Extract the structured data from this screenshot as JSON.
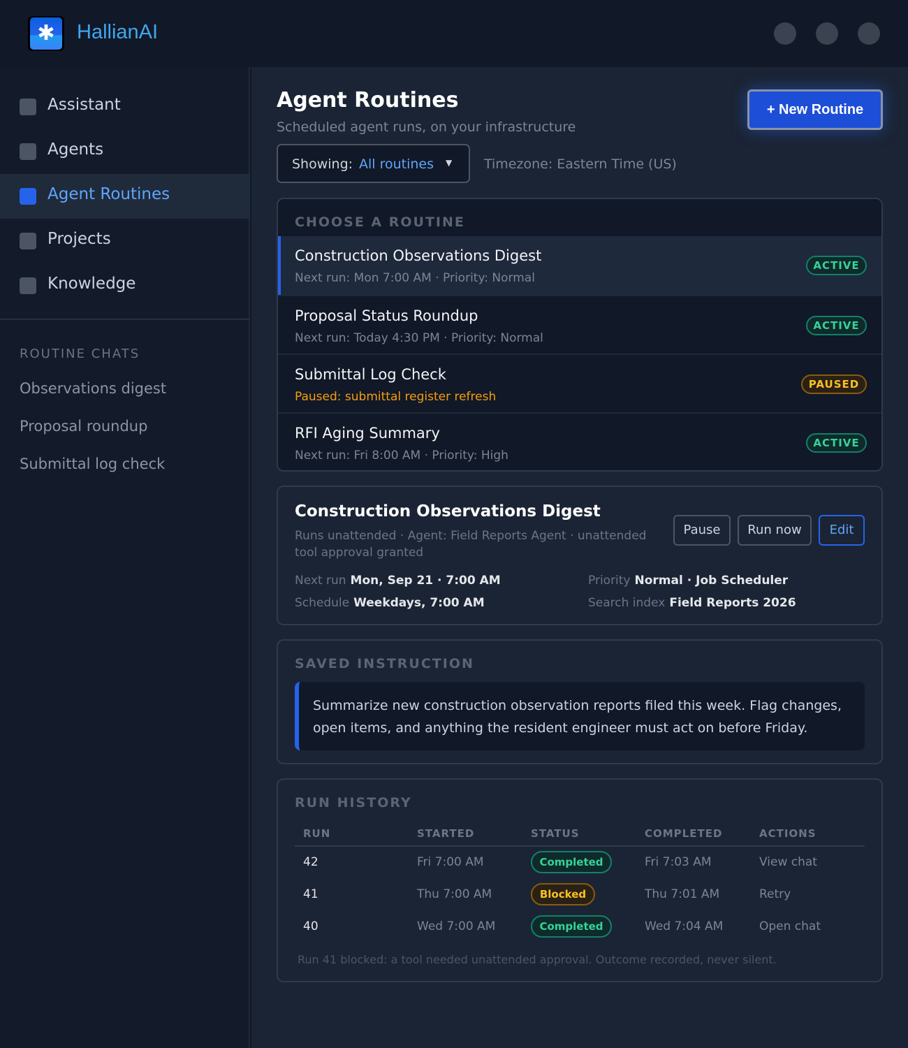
{
  "app": {
    "name": "HallianAI",
    "logo_icon": "asterisk-icon"
  },
  "sidebar": {
    "items": [
      {
        "label": "Assistant",
        "active": false
      },
      {
        "label": "Agents",
        "active": false
      },
      {
        "label": "Agent Routines",
        "active": true
      },
      {
        "label": "Projects",
        "active": false
      },
      {
        "label": "Knowledge",
        "active": false
      }
    ],
    "chats_heading": "ROUTINE CHATS",
    "chats": [
      "Observations digest",
      "Proposal roundup",
      "Submittal log check"
    ]
  },
  "header": {
    "title": "Agent Routines",
    "subtitle": "Scheduled agent runs, on your infrastructure",
    "new_button": "+ New Routine"
  },
  "filter": {
    "label": "Showing:",
    "value": "All routines",
    "timezone": "Timezone: Eastern Time (US)"
  },
  "routines": {
    "heading": "CHOOSE A ROUTINE",
    "items": [
      {
        "name": "Construction Observations Digest",
        "meta": "Next run: Mon 7:00 AM · Priority: Normal",
        "status": "ACTIVE",
        "selected": true
      },
      {
        "name": "Proposal Status Roundup",
        "meta": "Next run: Today 4:30 PM · Priority: Normal",
        "status": "ACTIVE",
        "selected": false
      },
      {
        "name": "Submittal Log Check",
        "meta": "Paused: submittal register refresh",
        "status": "PAUSED",
        "selected": false
      },
      {
        "name": "RFI Aging Summary",
        "meta": "Next run: Fri 8:00 AM · Priority: High",
        "status": "ACTIVE",
        "selected": false
      }
    ]
  },
  "detail": {
    "title": "Construction Observations Digest",
    "description": "Runs unattended · Agent: Field Reports Agent · unattended tool approval granted",
    "buttons": {
      "pause": "Pause",
      "run_now": "Run now",
      "edit": "Edit"
    },
    "next_run_label": "Next run",
    "next_run_value": "Mon, Sep 21 · 7:00 AM",
    "schedule_label": "Schedule",
    "schedule_value": "Weekdays, 7:00 AM",
    "priority_label": "Priority",
    "priority_value": "Normal · Job Scheduler",
    "index_label": "Search index",
    "index_value": "Field Reports 2026"
  },
  "instruction": {
    "heading": "SAVED INSTRUCTION",
    "text": "Summarize new construction observation reports filed this week. Flag changes, open items, and anything the resident engineer must act on before Friday."
  },
  "history": {
    "heading": "RUN HISTORY",
    "columns": [
      "RUN",
      "STARTED",
      "STATUS",
      "COMPLETED",
      "ACTIONS"
    ],
    "rows": [
      {
        "run": "42",
        "started": "Fri 7:00 AM",
        "status": "Completed",
        "completed": "Fri 7:03 AM",
        "action": "View chat"
      },
      {
        "run": "41",
        "started": "Thu 7:00 AM",
        "status": "Blocked",
        "completed": "Thu 7:01 AM",
        "action": "Retry"
      },
      {
        "run": "40",
        "started": "Wed 7:00 AM",
        "status": "Completed",
        "completed": "Wed 7:04 AM",
        "action": "Open chat"
      }
    ],
    "note": "Run 41 blocked: a tool needed unattended approval. Outcome recorded, never silent."
  },
  "colors": {
    "accent": "#2563eb",
    "brand": "#3fa7ee",
    "active": "#34d399",
    "warning": "#f59e0b"
  }
}
